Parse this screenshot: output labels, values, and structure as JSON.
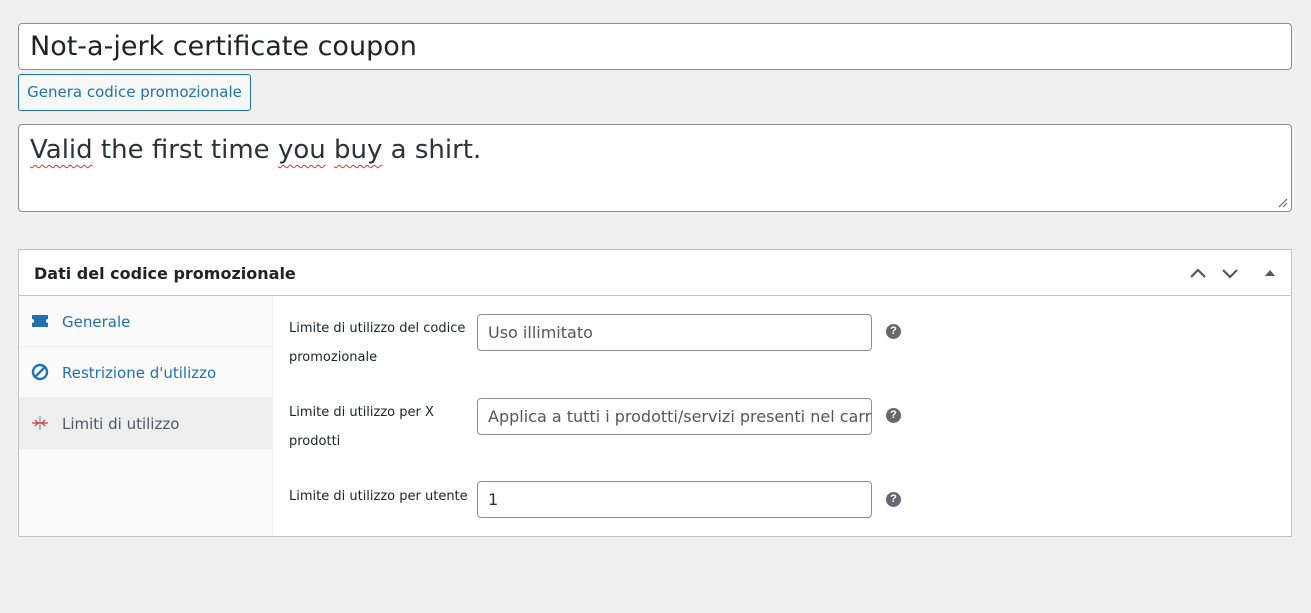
{
  "coupon": {
    "title": "Not-a-jerk certificate coupon",
    "generate_button": "Genera codice promozionale",
    "description": {
      "words": [
        "Valid",
        "the first time",
        "you",
        "buy",
        "a shirt."
      ],
      "spellcheck_flagged": [
        "Valid",
        "you",
        "buy"
      ]
    }
  },
  "panel": {
    "title": "Dati del codice promozionale",
    "tabs": [
      {
        "label": "Generale",
        "icon": "ticket-icon",
        "active": false
      },
      {
        "label": "Restrizione d'utilizzo",
        "icon": "ban-icon",
        "active": false
      },
      {
        "label": "Limiti di utilizzo",
        "icon": "limits-icon",
        "active": true
      }
    ],
    "fields": [
      {
        "label": "Limite di utilizzo del codice promozionale",
        "placeholder": "Uso illimitato",
        "value": ""
      },
      {
        "label": "Limite di utilizzo per X prodotti",
        "placeholder": "Applica a tutti i prodotti/servizi presenti nel carrello",
        "value": ""
      },
      {
        "label": "Limite di utilizzo per utente",
        "placeholder": "",
        "value": "1"
      }
    ],
    "help_glyph": "?"
  },
  "colors": {
    "link": "#2271b1",
    "background": "#f0f0f1",
    "spellcheck": "#d63638"
  }
}
